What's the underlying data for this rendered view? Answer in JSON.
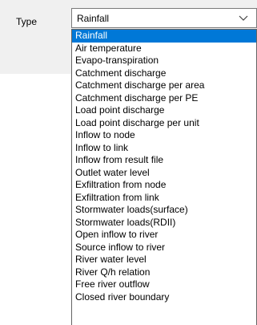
{
  "form": {
    "type_label": "Type",
    "selected_value": "Rainfall"
  },
  "icons": {
    "dropdown_arrow": "chevron-down-icon"
  },
  "colors": {
    "selection": "#0078d7",
    "panel": "#f0f0f0"
  },
  "dropdown": {
    "selected_index": 0,
    "options": [
      "Rainfall",
      "Air temperature",
      "Evapo-transpiration",
      "Catchment discharge",
      "Catchment discharge per area",
      "Catchment discharge per PE",
      "Load point discharge",
      "Load point discharge per unit",
      "Inflow to node",
      "Inflow to link",
      "Inflow from result file",
      "Outlet water level",
      "Exfiltration from node",
      "Exfiltration from link",
      "Stormwater loads(surface)",
      "Stormwater loads(RDII)",
      "Open inflow to river",
      "Source inflow to river",
      "River water level",
      "River Q/h relation",
      "Free river outflow",
      "Closed river boundary"
    ]
  }
}
